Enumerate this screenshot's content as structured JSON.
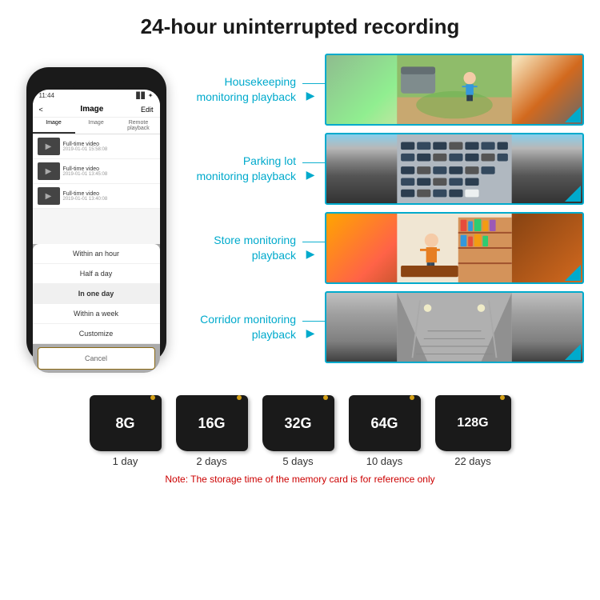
{
  "header": {
    "title": "24-hour uninterrupted recording"
  },
  "phone": {
    "status_time": "11:44",
    "nav_back": "<",
    "nav_title": "Image",
    "nav_edit": "Edit",
    "tabs": [
      "Image",
      "Image",
      "Remote playback"
    ],
    "list_items": [
      {
        "title": "Full-time video",
        "date": "2019-01-01 15:58:08"
      },
      {
        "title": "Full-time video",
        "date": "2019-01-01 13:45:08"
      },
      {
        "title": "Full-time video",
        "date": "2019-01-01 13:40:08"
      }
    ],
    "dropdown_items": [
      "Within an hour",
      "Half a day",
      "In one day",
      "Within a week",
      "Customize"
    ],
    "dropdown_cancel": "Cancel",
    "highlighted_item": "In one day"
  },
  "monitoring": [
    {
      "label": "Housekeeping\nmonitoring playback",
      "image_type": "housekeeping"
    },
    {
      "label": "Parking lot\nmonitoring playback",
      "image_type": "parking"
    },
    {
      "label": "Store monitoring\nplayback",
      "image_type": "store"
    },
    {
      "label": "Corridor monitoring\nplayback",
      "image_type": "corridor"
    }
  ],
  "sdcards": [
    {
      "size": "8G",
      "days": "1 day"
    },
    {
      "size": "16G",
      "days": "2 days"
    },
    {
      "size": "32G",
      "days": "5 days"
    },
    {
      "size": "64G",
      "days": "10 days"
    },
    {
      "size": "128G",
      "days": "22 days"
    }
  ],
  "note": "Note: The storage time of the memory card is for reference only",
  "colors": {
    "accent": "#00aacc",
    "note_red": "#cc0000",
    "phone_bg": "#1a1a1a",
    "sdcard_bg": "#1a1a1a"
  }
}
